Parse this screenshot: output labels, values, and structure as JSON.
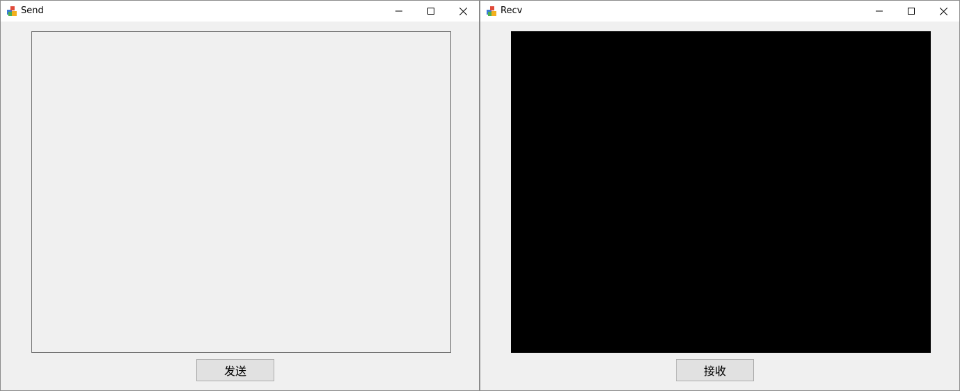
{
  "windows": {
    "send": {
      "title": "Send",
      "button_label": "发送"
    },
    "recv": {
      "title": "Recv",
      "button_label": "接收"
    }
  },
  "icons": {
    "app": "app-icon",
    "minimize": "minimize-icon",
    "maximize": "maximize-icon",
    "close": "close-icon"
  },
  "colors": {
    "recv_panel": "#000000",
    "window_bg": "#f0f0f0",
    "titlebar_bg": "#ffffff"
  }
}
